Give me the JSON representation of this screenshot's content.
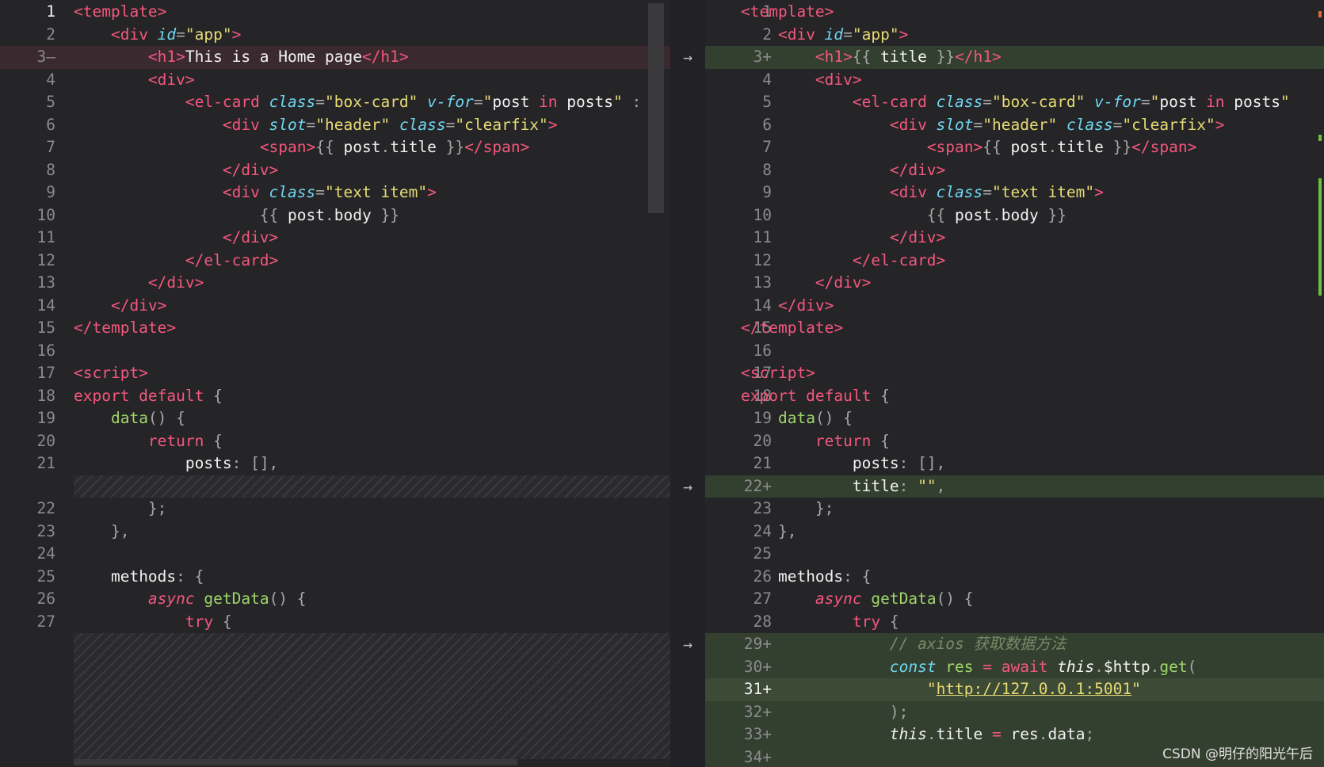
{
  "left": {
    "rows": [
      {
        "ln": "1",
        "state": "cur"
      },
      {
        "ln": "2"
      },
      {
        "ln": "3—",
        "state": "del"
      },
      {
        "ln": "4"
      },
      {
        "ln": "5"
      },
      {
        "ln": "6"
      },
      {
        "ln": "7"
      },
      {
        "ln": "8"
      },
      {
        "ln": "9"
      },
      {
        "ln": "10"
      },
      {
        "ln": "11"
      },
      {
        "ln": "12"
      },
      {
        "ln": "13"
      },
      {
        "ln": "14"
      },
      {
        "ln": "15"
      },
      {
        "ln": "16"
      },
      {
        "ln": "17"
      },
      {
        "ln": "18"
      },
      {
        "ln": "19"
      },
      {
        "ln": "20"
      },
      {
        "ln": "21"
      },
      {
        "ln": "",
        "state": "hatch"
      },
      {
        "ln": "22"
      },
      {
        "ln": "23"
      },
      {
        "ln": "24"
      },
      {
        "ln": "25"
      },
      {
        "ln": "26"
      },
      {
        "ln": "27"
      }
    ],
    "code": [
      [
        [
          "t",
          "<template>"
        ]
      ],
      [
        [
          "p",
          "    "
        ],
        [
          "t",
          "<div "
        ],
        [
          "a",
          "id"
        ],
        [
          "p",
          "="
        ],
        [
          "s",
          "\"app\""
        ],
        [
          "t",
          ">"
        ]
      ],
      [
        [
          "p",
          "        "
        ],
        [
          "t",
          "<h1>"
        ],
        [
          "w",
          "This is a Home page"
        ],
        [
          "t",
          "</h1>"
        ]
      ],
      [
        [
          "p",
          "        "
        ],
        [
          "t",
          "<div>"
        ]
      ],
      [
        [
          "p",
          "            "
        ],
        [
          "t",
          "<el-card "
        ],
        [
          "a",
          "class"
        ],
        [
          "p",
          "="
        ],
        [
          "s",
          "\"box-card\" "
        ],
        [
          "a",
          "v-for"
        ],
        [
          "p",
          "="
        ],
        [
          "s",
          "\""
        ],
        [
          "w",
          "post "
        ],
        [
          "k",
          "in "
        ],
        [
          "w",
          "posts"
        ],
        [
          "s",
          "\""
        ],
        [
          "p",
          " :"
        ]
      ],
      [
        [
          "p",
          "                "
        ],
        [
          "t",
          "<div "
        ],
        [
          "a",
          "slot"
        ],
        [
          "p",
          "="
        ],
        [
          "s",
          "\"header\" "
        ],
        [
          "a",
          "class"
        ],
        [
          "p",
          "="
        ],
        [
          "s",
          "\"clearfix\""
        ],
        [
          "t",
          ">"
        ]
      ],
      [
        [
          "p",
          "                    "
        ],
        [
          "t",
          "<span>"
        ],
        [
          "p",
          "{{ "
        ],
        [
          "w",
          "post"
        ],
        [
          "p",
          "."
        ],
        [
          "w",
          "title"
        ],
        [
          "p",
          " }}"
        ],
        [
          "t",
          "</span>"
        ]
      ],
      [
        [
          "p",
          "                "
        ],
        [
          "t",
          "</div>"
        ]
      ],
      [
        [
          "p",
          "                "
        ],
        [
          "t",
          "<div "
        ],
        [
          "a",
          "class"
        ],
        [
          "p",
          "="
        ],
        [
          "s",
          "\"text item\""
        ],
        [
          "t",
          ">"
        ]
      ],
      [
        [
          "p",
          "                    {{ "
        ],
        [
          "w",
          "post"
        ],
        [
          "p",
          "."
        ],
        [
          "w",
          "body"
        ],
        [
          "p",
          " }}"
        ]
      ],
      [
        [
          "p",
          "                "
        ],
        [
          "t",
          "</div>"
        ]
      ],
      [
        [
          "p",
          "            "
        ],
        [
          "t",
          "</el-card>"
        ]
      ],
      [
        [
          "p",
          "        "
        ],
        [
          "t",
          "</div>"
        ]
      ],
      [
        [
          "p",
          "    "
        ],
        [
          "t",
          "</div>"
        ]
      ],
      [
        [
          "t",
          "</template>"
        ]
      ],
      [],
      [
        [
          "t",
          "<script>"
        ]
      ],
      [
        [
          "k",
          "export default "
        ],
        [
          "p",
          "{"
        ]
      ],
      [
        [
          "p",
          "    "
        ],
        [
          "f",
          "data"
        ],
        [
          "p",
          "() {"
        ]
      ],
      [
        [
          "p",
          "        "
        ],
        [
          "k",
          "return "
        ],
        [
          "p",
          "{"
        ]
      ],
      [
        [
          "p",
          "            "
        ],
        [
          "w",
          "posts"
        ],
        [
          "p",
          ": [],"
        ]
      ],
      [],
      [
        [
          "p",
          "        };"
        ]
      ],
      [
        [
          "p",
          "    },"
        ]
      ],
      [],
      [
        [
          "p",
          "    "
        ],
        [
          "w",
          "methods"
        ],
        [
          "p",
          ": {"
        ]
      ],
      [
        [
          "p",
          "        "
        ],
        [
          "i",
          "async "
        ],
        [
          "f",
          "getData"
        ],
        [
          "p",
          "() {"
        ]
      ],
      [
        [
          "p",
          "            "
        ],
        [
          "k",
          "try "
        ],
        [
          "p",
          "{"
        ]
      ]
    ]
  },
  "right": {
    "rows": [
      {
        "ln": "1"
      },
      {
        "ln": "2"
      },
      {
        "ln": "3+",
        "state": "add"
      },
      {
        "ln": "4"
      },
      {
        "ln": "5"
      },
      {
        "ln": "6"
      },
      {
        "ln": "7"
      },
      {
        "ln": "8"
      },
      {
        "ln": "9"
      },
      {
        "ln": "10"
      },
      {
        "ln": "11"
      },
      {
        "ln": "12"
      },
      {
        "ln": "13"
      },
      {
        "ln": "14"
      },
      {
        "ln": "15"
      },
      {
        "ln": "16"
      },
      {
        "ln": "17"
      },
      {
        "ln": "18"
      },
      {
        "ln": "19"
      },
      {
        "ln": "20"
      },
      {
        "ln": "21"
      },
      {
        "ln": "22+",
        "state": "add"
      },
      {
        "ln": "23"
      },
      {
        "ln": "24"
      },
      {
        "ln": "25"
      },
      {
        "ln": "26"
      },
      {
        "ln": "27"
      },
      {
        "ln": "28"
      },
      {
        "ln": "29+",
        "state": "add"
      },
      {
        "ln": "30+",
        "state": "add"
      },
      {
        "ln": "31+",
        "state": "add-strong cur"
      },
      {
        "ln": "32+",
        "state": "add"
      },
      {
        "ln": "33+",
        "state": "add"
      },
      {
        "ln": "34+",
        "state": "add"
      }
    ],
    "code": [
      [
        [
          "t",
          "<template>"
        ]
      ],
      [
        [
          "p",
          "    "
        ],
        [
          "t",
          "<div "
        ],
        [
          "a",
          "id"
        ],
        [
          "p",
          "="
        ],
        [
          "s",
          "\"app\""
        ],
        [
          "t",
          ">"
        ]
      ],
      [
        [
          "p",
          "        "
        ],
        [
          "t",
          "<h1>"
        ],
        [
          "p",
          "{{ "
        ],
        [
          "w",
          "title"
        ],
        [
          "p",
          " }}"
        ],
        [
          "t",
          "</h1>"
        ]
      ],
      [
        [
          "p",
          "        "
        ],
        [
          "t",
          "<div>"
        ]
      ],
      [
        [
          "p",
          "            "
        ],
        [
          "t",
          "<el-card "
        ],
        [
          "a",
          "class"
        ],
        [
          "p",
          "="
        ],
        [
          "s",
          "\"box-card\" "
        ],
        [
          "a",
          "v-for"
        ],
        [
          "p",
          "="
        ],
        [
          "s",
          "\""
        ],
        [
          "w",
          "post "
        ],
        [
          "k",
          "in "
        ],
        [
          "w",
          "posts"
        ],
        [
          "s",
          "\""
        ]
      ],
      [
        [
          "p",
          "                "
        ],
        [
          "t",
          "<div "
        ],
        [
          "a",
          "slot"
        ],
        [
          "p",
          "="
        ],
        [
          "s",
          "\"header\" "
        ],
        [
          "a",
          "class"
        ],
        [
          "p",
          "="
        ],
        [
          "s",
          "\"clearfix\""
        ],
        [
          "t",
          ">"
        ]
      ],
      [
        [
          "p",
          "                    "
        ],
        [
          "t",
          "<span>"
        ],
        [
          "p",
          "{{ "
        ],
        [
          "w",
          "post"
        ],
        [
          "p",
          "."
        ],
        [
          "w",
          "title"
        ],
        [
          "p",
          " }}"
        ],
        [
          "t",
          "</span>"
        ]
      ],
      [
        [
          "p",
          "                "
        ],
        [
          "t",
          "</div>"
        ]
      ],
      [
        [
          "p",
          "                "
        ],
        [
          "t",
          "<div "
        ],
        [
          "a",
          "class"
        ],
        [
          "p",
          "="
        ],
        [
          "s",
          "\"text item\""
        ],
        [
          "t",
          ">"
        ]
      ],
      [
        [
          "p",
          "                    {{ "
        ],
        [
          "w",
          "post"
        ],
        [
          "p",
          "."
        ],
        [
          "w",
          "body"
        ],
        [
          "p",
          " }}"
        ]
      ],
      [
        [
          "p",
          "                "
        ],
        [
          "t",
          "</div>"
        ]
      ],
      [
        [
          "p",
          "            "
        ],
        [
          "t",
          "</el-card>"
        ]
      ],
      [
        [
          "p",
          "        "
        ],
        [
          "t",
          "</div>"
        ]
      ],
      [
        [
          "p",
          "    "
        ],
        [
          "t",
          "</div>"
        ]
      ],
      [
        [
          "t",
          "</template>"
        ]
      ],
      [],
      [
        [
          "t",
          "<script>"
        ]
      ],
      [
        [
          "k",
          "export default "
        ],
        [
          "p",
          "{"
        ]
      ],
      [
        [
          "p",
          "    "
        ],
        [
          "f",
          "data"
        ],
        [
          "p",
          "() {"
        ]
      ],
      [
        [
          "p",
          "        "
        ],
        [
          "k",
          "return "
        ],
        [
          "p",
          "{"
        ]
      ],
      [
        [
          "p",
          "            "
        ],
        [
          "w",
          "posts"
        ],
        [
          "p",
          ": [],"
        ]
      ],
      [
        [
          "p",
          "            "
        ],
        [
          "w",
          "title"
        ],
        [
          "p",
          ": "
        ],
        [
          "s",
          "\"\""
        ],
        [
          "p",
          ","
        ]
      ],
      [
        [
          "p",
          "        };"
        ]
      ],
      [
        [
          "p",
          "    },"
        ]
      ],
      [],
      [
        [
          "p",
          "    "
        ],
        [
          "w",
          "methods"
        ],
        [
          "p",
          ": {"
        ]
      ],
      [
        [
          "p",
          "        "
        ],
        [
          "i",
          "async "
        ],
        [
          "f",
          "getData"
        ],
        [
          "p",
          "() {"
        ]
      ],
      [
        [
          "p",
          "            "
        ],
        [
          "k",
          "try "
        ],
        [
          "p",
          "{"
        ]
      ],
      [
        [
          "p",
          "                "
        ],
        [
          "c",
          "// axios 获取数据方法"
        ]
      ],
      [
        [
          "p",
          "                "
        ],
        [
          "a",
          "const "
        ],
        [
          "f",
          "res "
        ],
        [
          "k",
          "= await "
        ],
        [
          "th",
          "this"
        ],
        [
          "p",
          "."
        ],
        [
          "w",
          "$http"
        ],
        [
          "p",
          "."
        ],
        [
          "f",
          "get"
        ],
        [
          "p",
          "("
        ]
      ],
      [
        [
          "p",
          "                    "
        ],
        [
          "s",
          "\""
        ],
        [
          "u",
          "http://127.0.0.1:5001"
        ],
        [
          "s",
          "\""
        ]
      ],
      [
        [
          "p",
          "                );"
        ]
      ],
      [
        [
          "p",
          "                "
        ],
        [
          "th",
          "this"
        ],
        [
          "p",
          "."
        ],
        [
          "w",
          "title "
        ],
        [
          "k",
          "= "
        ],
        [
          "w",
          "res"
        ],
        [
          "p",
          "."
        ],
        [
          "w",
          "data"
        ],
        [
          "p",
          ";"
        ]
      ],
      []
    ]
  },
  "gutter_arrows": [
    {
      "row": 2,
      "glyph": "→"
    },
    {
      "row": 21,
      "glyph": "→"
    },
    {
      "row": 28,
      "glyph": "→"
    }
  ],
  "watermark": "CSDN @明仔的阳光午后"
}
